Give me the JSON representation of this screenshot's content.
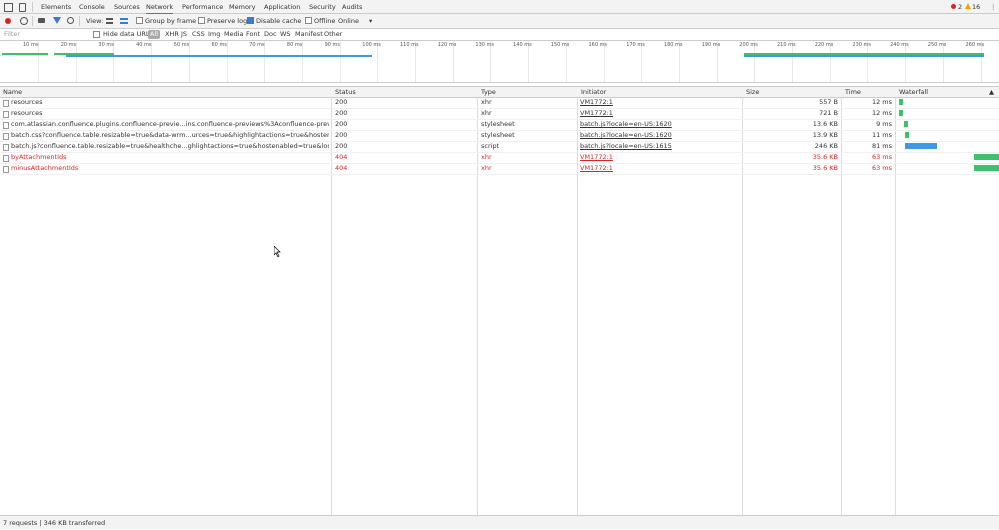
{
  "tabs": [
    "Elements",
    "Console",
    "Sources",
    "Network",
    "Performance",
    "Memory",
    "Application",
    "Security",
    "Audits"
  ],
  "active_tab": "Network",
  "badges": {
    "errors": "2",
    "warnings": "16"
  },
  "toolbar": {
    "view_label": "View:",
    "group_by_frame": "Group by frame",
    "preserve_log": "Preserve log",
    "disable_cache": "Disable cache",
    "offline": "Offline",
    "throttle": "Online"
  },
  "filterbar": {
    "placeholder": "Filter",
    "hide_data_urls": "Hide data URLs",
    "types": [
      "All",
      "XHR",
      "JS",
      "CSS",
      "Img",
      "Media",
      "Font",
      "Doc",
      "WS",
      "Manifest",
      "Other"
    ]
  },
  "overview_ticks": [
    "10 ms",
    "20 ms",
    "30 ms",
    "40 ms",
    "50 ms",
    "60 ms",
    "70 ms",
    "80 ms",
    "90 ms",
    "100 ms",
    "110 ms",
    "120 ms",
    "130 ms",
    "140 ms",
    "150 ms",
    "160 ms",
    "170 ms",
    "180 ms",
    "190 ms",
    "200 ms",
    "210 ms",
    "220 ms",
    "230 ms",
    "240 ms",
    "250 ms",
    "260 ms"
  ],
  "columns": {
    "name": "Name",
    "status": "Status",
    "type": "Type",
    "initiator": "Initiator",
    "size": "Size",
    "time": "Time",
    "waterfall": "Waterfall"
  },
  "rows": [
    {
      "name": "resources",
      "status": "200",
      "type": "xhr",
      "initiator": "VM1772:1",
      "size": "557 B",
      "time": "12 ms",
      "error": false
    },
    {
      "name": "resources",
      "status": "200",
      "type": "xhr",
      "initiator": "VM1772:1",
      "size": "721 B",
      "time": "12 ms",
      "error": false
    },
    {
      "name": "com.atlassian.confluence.plugins.confluence-previe...ins.confluence-previews%3Aconfluence-previews-css",
      "status": "200",
      "type": "stylesheet",
      "initiator": "batch.js?locale=en-US:1620",
      "size": "13.6 KB",
      "time": "9 ms",
      "error": false
    },
    {
      "name": "batch.css?confluence.table.resizable=true&data-wrm...urces=true&highlightactions=true&hostenabled=true",
      "status": "200",
      "type": "stylesheet",
      "initiator": "batch.js?locale=en-US:1620",
      "size": "13.9 KB",
      "time": "11 ms",
      "error": false
    },
    {
      "name": "batch.js?confluence.table.resizable=true&healthche...ghlightactions=true&hostenabled=true&locale=en-US",
      "status": "200",
      "type": "script",
      "initiator": "batch.js?locale=en-US:1615",
      "size": "246 KB",
      "time": "81 ms",
      "error": false
    },
    {
      "name": "byAttachmentIds",
      "status": "404",
      "type": "xhr",
      "initiator": "VM1772:1",
      "size": "35.6 KB",
      "time": "63 ms",
      "error": true
    },
    {
      "name": "minusAttachmentIds",
      "status": "404",
      "type": "xhr",
      "initiator": "VM1772:1",
      "size": "35.6 KB",
      "time": "63 ms",
      "error": true
    }
  ],
  "status_bar": "7 requests  |  346 KB transferred",
  "colors": {
    "accent": "#3879d9",
    "error": "#d22222",
    "warning": "#f0a500",
    "bar_green": "#3cc36a",
    "bar_blue": "#3e9ae6"
  }
}
